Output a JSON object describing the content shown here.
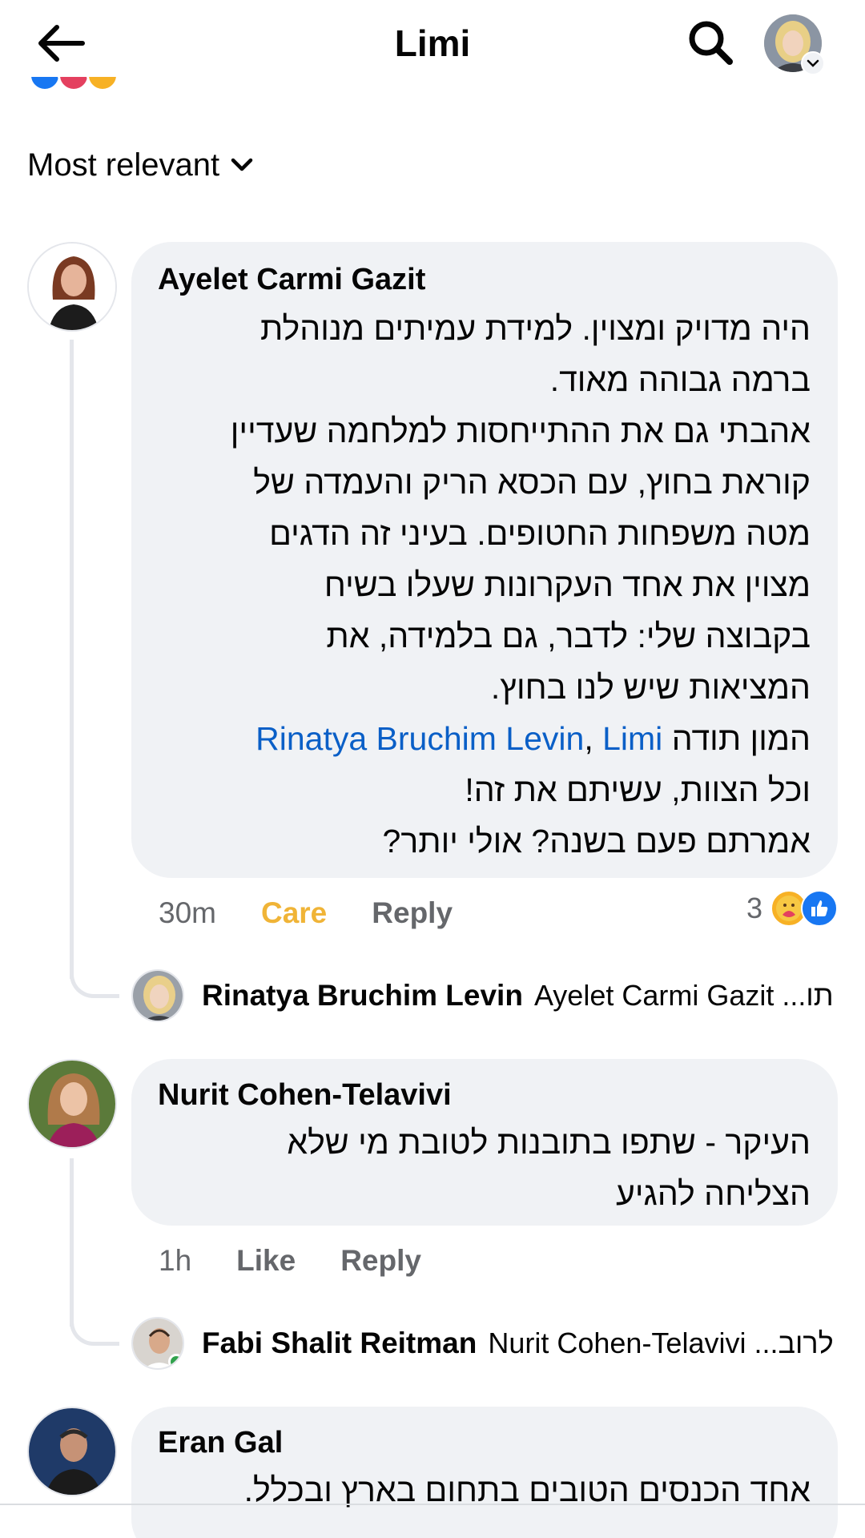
{
  "header": {
    "title": "Limi",
    "back_label": "Back",
    "search_label": "Search"
  },
  "sort": {
    "label": "Most relevant"
  },
  "comments": [
    {
      "author": "Ayelet Carmi Gazit",
      "body_lines": [
        "היה מדויק ומצוין. למידת עמיתים מנוהלת",
        "ברמה גבוהה מאוד.",
        "אהבתי גם את ההתייחסות למלחמה שעדיין",
        "קוראת בחוץ, עם הכסא הריק והעמדה של",
        "מטה משפחות החטופים. בעיני זה הדגים",
        "מצוין את אחד העקרונות שעלו בשיח",
        "בקבוצה שלי: לדבר, גם בלמידה, את",
        "המציאות שיש לנו בחוץ."
      ],
      "mention_line": {
        "prefix": "המון תודה ",
        "mention1": "Rinatya Bruchim Levin",
        "separator": ", ",
        "mention2": "Limi"
      },
      "body_lines_after": [
        "וכל הצוות, עשיתם את זה!",
        "אמרתם פעם בשנה? אולי יותר?"
      ],
      "time": "30m",
      "reaction_label": "Care",
      "reply_label": "Reply",
      "reaction_count": "3",
      "reply": {
        "author": "Rinatya Bruchim Levin",
        "preview": "Ayelet Carmi Gazit ...תו"
      }
    },
    {
      "author": "Nurit Cohen-Telavivi",
      "body_lines": [
        "העיקר - שתפו בתובנות לטובת מי שלא",
        "הצליחה להגיע"
      ],
      "time": "1h",
      "like_label": "Like",
      "reply_label": "Reply",
      "reply": {
        "author": "Fabi Shalit Reitman",
        "preview": "Nurit Cohen-Telavivi ...לרוב"
      }
    },
    {
      "author": "Eran Gal",
      "body_lines": [
        "אחד הכנסים הטובים בתחום בארץ ובכלל."
      ]
    }
  ],
  "colors": {
    "bubble": "#f0f2f5",
    "mention": "#0a5fc7",
    "care": "#f0b437",
    "muted": "#65676b",
    "like_blue": "#1877f2"
  },
  "icons": [
    "back-arrow-icon",
    "search-icon",
    "chevron-down-icon",
    "like-icon",
    "care-icon"
  ]
}
